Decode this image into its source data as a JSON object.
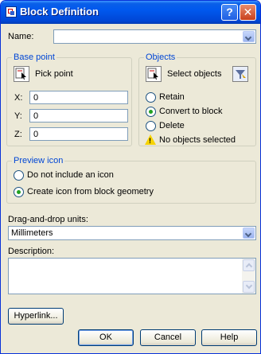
{
  "window": {
    "title": "Block Definition",
    "help_button": "?",
    "close_button": "✕"
  },
  "name": {
    "label": "Name:",
    "value": ""
  },
  "base_point": {
    "title": "Base point",
    "pick_point_label": "Pick point",
    "x_label": "X:",
    "x_value": "0",
    "y_label": "Y:",
    "y_value": "0",
    "z_label": "Z:",
    "z_value": "0"
  },
  "objects": {
    "title": "Objects",
    "select_objects_label": "Select objects",
    "options": [
      {
        "label": "Retain",
        "selected": false
      },
      {
        "label": "Convert to block",
        "selected": true
      },
      {
        "label": "Delete",
        "selected": false
      }
    ],
    "warning": "No objects selected"
  },
  "preview_icon": {
    "title": "Preview icon",
    "options": [
      {
        "label": "Do not include an icon",
        "selected": false
      },
      {
        "label": "Create icon from block geometry",
        "selected": true
      }
    ]
  },
  "units": {
    "label": "Drag-and-drop units:",
    "value": "Millimeters"
  },
  "description": {
    "label": "Description:",
    "value": ""
  },
  "buttons": {
    "hyperlink": "Hyperlink...",
    "ok": "OK",
    "cancel": "Cancel",
    "help": "Help"
  }
}
